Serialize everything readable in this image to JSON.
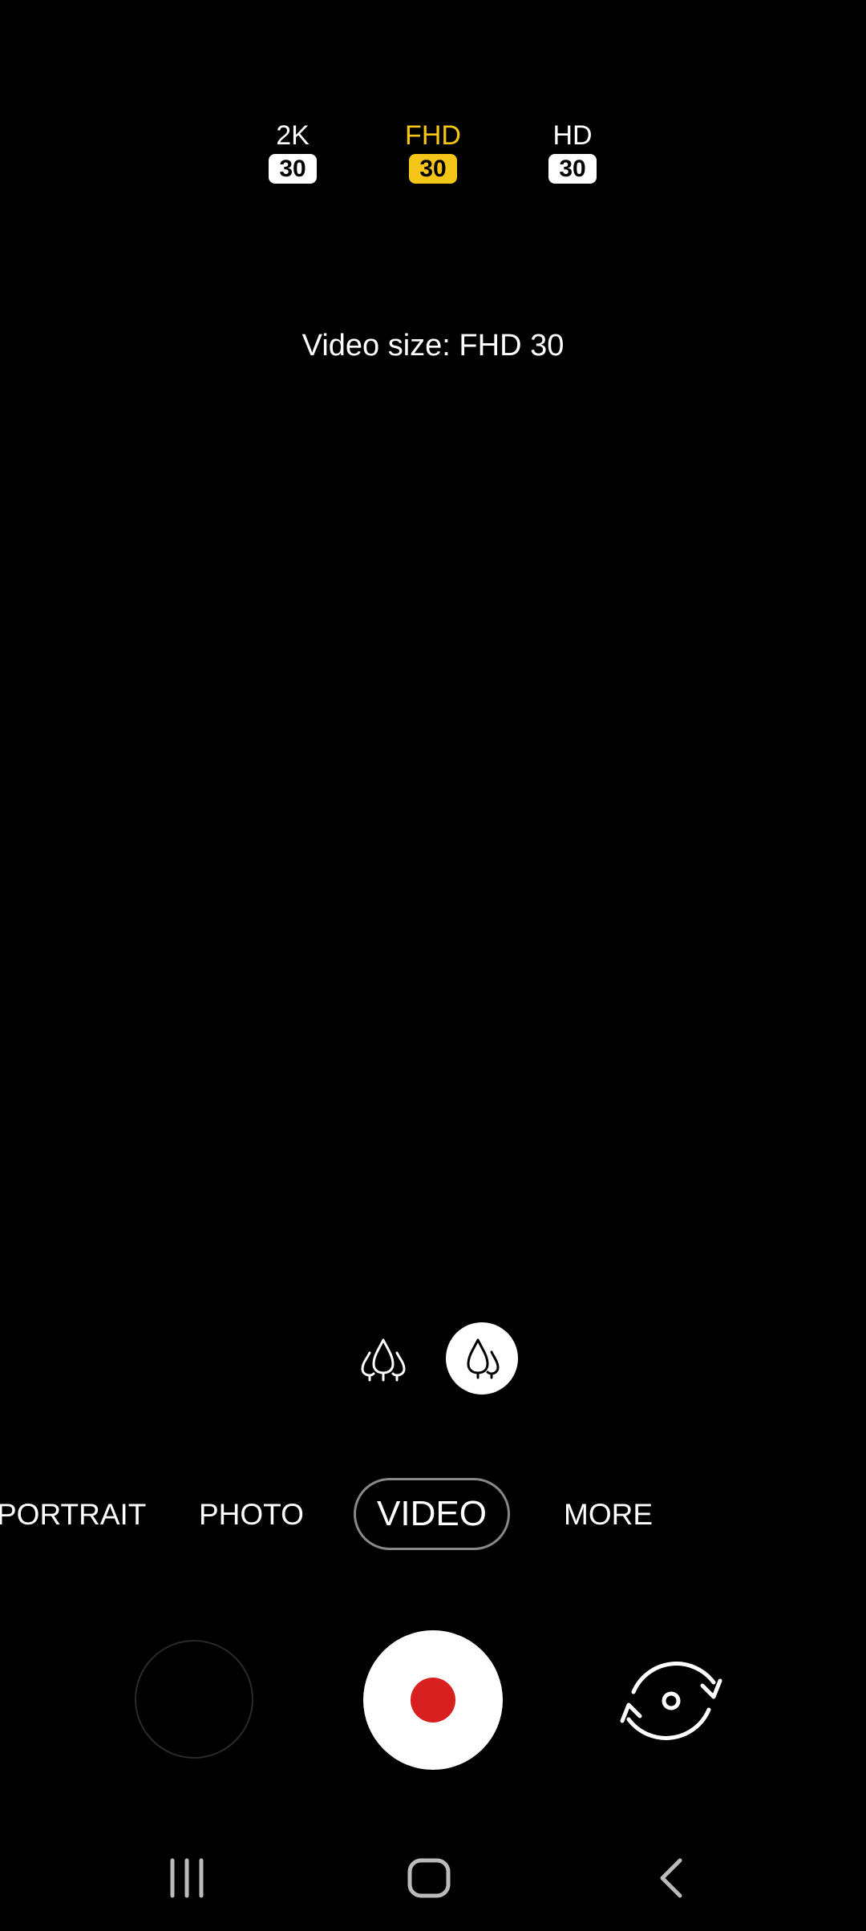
{
  "resolutions": [
    {
      "label": "2K",
      "fps": "30",
      "selected": false
    },
    {
      "label": "FHD",
      "fps": "30",
      "selected": true
    },
    {
      "label": "HD",
      "fps": "30",
      "selected": false
    }
  ],
  "toast": "Video size: FHD 30",
  "lens": {
    "wide_icon": "trees-wide-icon",
    "normal_icon": "trees-normal-icon",
    "selected": "normal"
  },
  "modes": [
    "PORTRAIT",
    "PHOTO",
    "VIDEO",
    "MORE"
  ],
  "selected_mode": "VIDEO",
  "controls": {
    "gallery_icon": "gallery-thumbnail",
    "record_icon": "record-icon",
    "switch_icon": "switch-camera-icon"
  },
  "nav": {
    "recent_icon": "recent-apps-icon",
    "home_icon": "home-icon",
    "back_icon": "back-icon"
  },
  "colors": {
    "accent": "#f5c518",
    "record": "#d8201f",
    "background": "#000000"
  }
}
